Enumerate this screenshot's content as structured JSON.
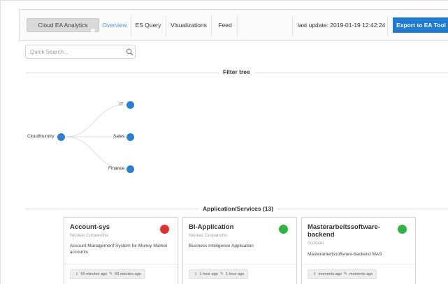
{
  "header": {
    "brand": "Cloud EA Analytics",
    "tabs": [
      {
        "label": "Overview",
        "active": true
      },
      {
        "label": "ES Query",
        "active": false
      },
      {
        "label": "Visualizations",
        "active": false
      },
      {
        "label": "Feed",
        "active": false
      }
    ],
    "last_update": "last update: 2019-01-19 12:42:24",
    "export_label": "Export to EA Tool"
  },
  "search": {
    "placeholder": "Quick Search...",
    "value": ""
  },
  "filter_tree": {
    "title": "Filter tree",
    "root": "Cloudfoundry",
    "children": [
      "IT",
      "Sales",
      "Finance"
    ],
    "node_color": "#2b7fd4"
  },
  "services": {
    "title": "Application/Services (13)",
    "cards": [
      {
        "title": "Account-sys",
        "author": "Nicolas Corpancho",
        "description": "Account Management System for Money Market accounts",
        "status_color": "#e03131",
        "created": "60 minutes ago",
        "edited": "60 minutes ago"
      },
      {
        "title": "BI-Application",
        "author": "Nicolas Corpancho",
        "description": "Business Inteligence Application",
        "status_color": "#2fb344",
        "created": "1 hour ago",
        "edited": "1 hour ago"
      },
      {
        "title": "Masterarbeitssoftware-backend",
        "author": "ncorpan",
        "description": "Masterarbeitssoftware-backend MAS",
        "status_color": "#2fb344",
        "created": "moments ago",
        "edited": "moments ago"
      }
    ]
  },
  "colors": {
    "accent": "#1f7ad1",
    "active_tab": "#4a90d9"
  }
}
